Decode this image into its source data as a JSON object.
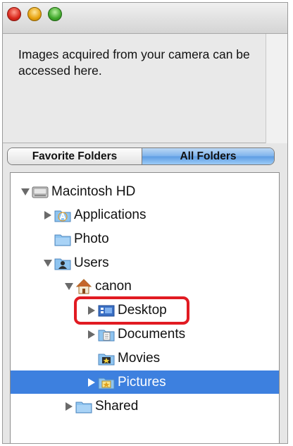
{
  "window": {
    "controls": [
      "close",
      "minimize",
      "zoom"
    ]
  },
  "info": {
    "text": "Images acquired from your camera can be accessed here."
  },
  "tabs": [
    {
      "label": "Favorite Folders",
      "selected": false
    },
    {
      "label": "All Folders",
      "selected": true
    }
  ],
  "tree": {
    "items": [
      {
        "label": "Macintosh HD",
        "icon": "hard-drive-icon",
        "expander": "expanded"
      },
      {
        "label": "Applications",
        "icon": "applications-folder-icon",
        "expander": "collapsed"
      },
      {
        "label": "Photo",
        "icon": "folder-icon",
        "expander": "none"
      },
      {
        "label": "Users",
        "icon": "users-folder-icon",
        "expander": "expanded"
      },
      {
        "label": "canon",
        "icon": "home-icon",
        "expander": "expanded"
      },
      {
        "label": "Desktop",
        "icon": "desktop-folder-icon",
        "expander": "collapsed",
        "highlighted": true
      },
      {
        "label": "Documents",
        "icon": "documents-folder-icon",
        "expander": "collapsed"
      },
      {
        "label": "Movies",
        "icon": "movies-folder-icon",
        "expander": "none"
      },
      {
        "label": "Pictures",
        "icon": "pictures-folder-icon",
        "expander": "collapsed",
        "selected": true
      },
      {
        "label": "Shared",
        "icon": "folder-icon",
        "expander": "collapsed"
      }
    ]
  },
  "colors": {
    "selection": "#3d80df",
    "highlight_border": "#e11b22",
    "tab_active": "#7eb3ec"
  }
}
